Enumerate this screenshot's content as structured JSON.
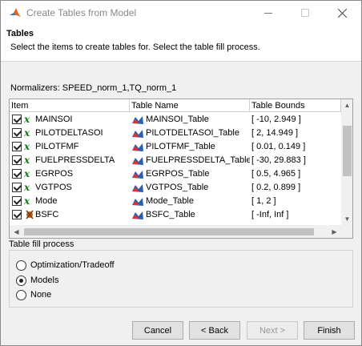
{
  "window": {
    "title": "Create Tables from Model"
  },
  "header": {
    "title": "Tables",
    "subtitle": "Select the items to create tables for. Select the table fill process."
  },
  "normalizers": "Normalizers: SPEED_norm_1,TQ_norm_1",
  "table": {
    "columns": [
      "Item",
      "Table Name",
      "Table Bounds"
    ],
    "rows": [
      {
        "item": "MAINSOI",
        "name": "MAINSOI_Table",
        "bounds": "[ -10, 2.949 ]",
        "icon": "x-variable-icon"
      },
      {
        "item": "PILOTDELTASOI",
        "name": "PILOTDELTASOI_Table",
        "bounds": "[ 2, 14.949 ]",
        "icon": "x-variable-icon"
      },
      {
        "item": "PILOTFMF",
        "name": "PILOTFMF_Table",
        "bounds": "[ 0.01, 0.149 ]",
        "icon": "x-variable-icon"
      },
      {
        "item": "FUELPRESSDELTA",
        "name": "FUELPRESSDELTA_Table",
        "bounds": "[ -30, 29.883 ]",
        "icon": "x-variable-icon"
      },
      {
        "item": "EGRPOS",
        "name": "EGRPOS_Table",
        "bounds": "[ 0.5, 4.965 ]",
        "icon": "x-variable-icon"
      },
      {
        "item": "VGTPOS",
        "name": "VGTPOS_Table",
        "bounds": "[ 0.2, 0.899 ]",
        "icon": "x-variable-icon"
      },
      {
        "item": "Mode",
        "name": "Mode_Table",
        "bounds": "[ 1, 2 ]",
        "icon": "x-variable-icon"
      },
      {
        "item": "BSFC",
        "name": "BSFC_Table",
        "bounds": "[ -Inf, Inf ]",
        "icon": "model-response-icon"
      }
    ]
  },
  "fill_process": {
    "legend": "Table fill process",
    "options": [
      {
        "label": "Optimization/Tradeoff",
        "selected": false
      },
      {
        "label": "Models",
        "selected": true
      },
      {
        "label": "None",
        "selected": false
      }
    ]
  },
  "buttons": {
    "cancel": "Cancel",
    "back": "< Back",
    "next": "Next >",
    "finish": "Finish"
  }
}
